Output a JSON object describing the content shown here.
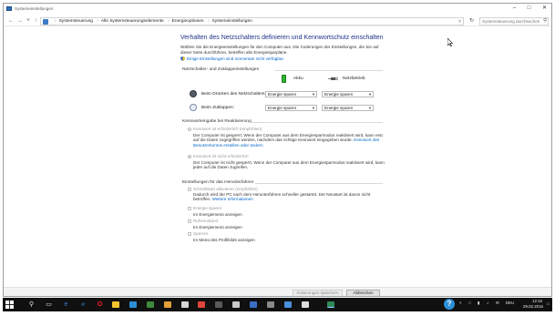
{
  "window": {
    "title": "Systemeinstellungen"
  },
  "navigation": {
    "breadcrumb": [
      "Systemsteuerung",
      "Alle Systemsteuerungselemente",
      "Energieoptionen",
      "Systemeinstellungen"
    ],
    "search_placeholder": "Systemsteuerung durchsuchen"
  },
  "main": {
    "title": "Verhalten des Netzschalters definieren und Kennwortschutz einschalten",
    "description": "Wählen Sie die Energieeinstellungen für den Computer aus. Die Änderungen der Einstellungen, die Sie auf dieser Seite durchführen, betreffen alle Energiesparpläne.",
    "uac_link": "Einige Einstellungen sind momentan nicht verfügbar.",
    "power_section": {
      "heading": "Netzschalter- und Zuklappeinstellungen",
      "col_battery": "Akku",
      "col_plugged": "Netzbetrieb",
      "rows": [
        {
          "label": "Beim Drücken des Netzschalters:",
          "battery": "Energie sparen",
          "plugged": "Energie sparen"
        },
        {
          "label": "Beim Zuklappen:",
          "battery": "Energie sparen",
          "plugged": "Energie sparen"
        }
      ]
    },
    "password_section": {
      "heading": "Kennworteingabe bei Reaktivierung",
      "options": [
        {
          "label": "Kennwort ist erforderlich (empfohlen)",
          "desc": "Der Computer ist gesperrt. Wenn der Computer aus dem Energiesparmodus reaktiviert wird, kann erst auf die Daten zugegriffen werden, nachdem das richtige Kennwort eingegeben wurde.",
          "link": "Kennwort des Benutzerkontos erstellen oder ändern"
        },
        {
          "label": "Kennwort ist nicht erforderlich",
          "desc": "Der Computer ist nicht gesperrt. Wenn der Computer aus dem Energiesparmodus reaktiviert wird, kann jeder auf die Daten zugreifen."
        }
      ]
    },
    "shutdown_section": {
      "heading": "Einstellungen für das Herunterfahren",
      "items": [
        {
          "label": "Schnellstart aktivieren (empfohlen)",
          "desc": "Dadurch wird der PC nach dem Herunterfahren schneller gestartet. Der Neustart ist davon nicht betroffen.",
          "link": "Weitere Informationen"
        },
        {
          "label": "Energie sparen",
          "sub": "Im Energiemenü anzeigen"
        },
        {
          "label": "Ruhezustand",
          "sub": "Im Energiemenü anzeigen"
        },
        {
          "label": "Sperren",
          "sub": "Im Menü des Profilbilds anzeigen"
        }
      ]
    }
  },
  "footer": {
    "save": "Änderungen speichern",
    "cancel": "Abbrechen"
  },
  "taskbar": {
    "language": "DEU",
    "time": "12:16",
    "date": "29.02.2016"
  },
  "colors": {
    "title_blue": "#1e3287",
    "link_blue": "#0066cc",
    "taskbar": "#101010"
  }
}
